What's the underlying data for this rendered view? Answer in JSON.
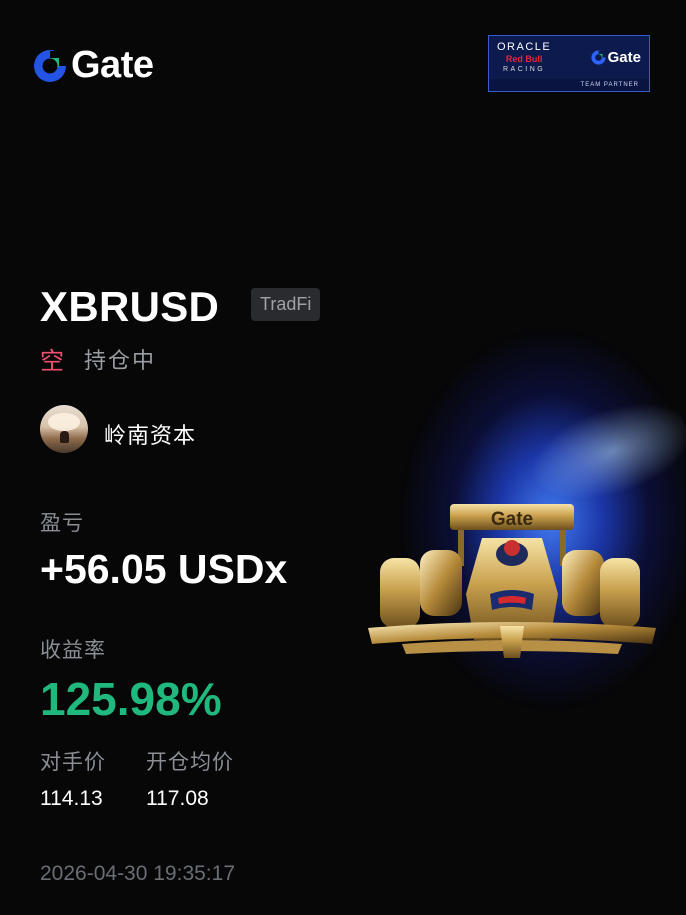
{
  "brand": {
    "logo_text": "Gate",
    "partner": {
      "oracle": "ORACLE",
      "redbull": "Red Bull",
      "racing": "RACING",
      "gate_text": "Gate",
      "footer": "TEAM PARTNER"
    },
    "car_wing_text": "Gate"
  },
  "position": {
    "symbol": "XBRUSD",
    "tag": "TradFi",
    "side": "空",
    "status": "持仓中"
  },
  "user": {
    "name": "岭南资本",
    "avatar_icon": "avatar-photo"
  },
  "pnl": {
    "label": "盈亏",
    "value": "+56.05 USDx"
  },
  "roi": {
    "label": "收益率",
    "value": "125.98%"
  },
  "prices": {
    "mark_label": "对手价",
    "mark_value": "114.13",
    "entry_label": "开仓均价",
    "entry_value": "117.08"
  },
  "timestamp": "2026-04-30 19:35:17",
  "colors": {
    "background": "#070708",
    "short": "#f0506e",
    "profit": "#21b87e",
    "muted": "#8b8e95",
    "logo_blue": "#2354e6"
  }
}
